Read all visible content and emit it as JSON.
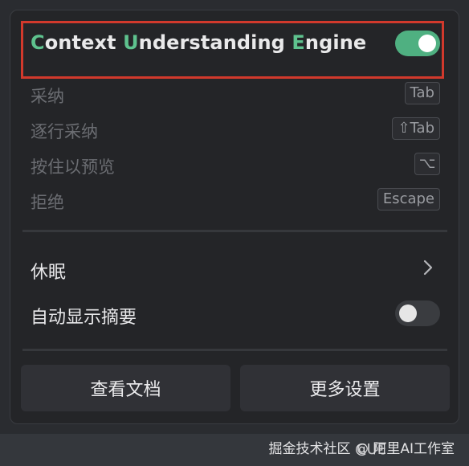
{
  "header": {
    "title_parts": [
      {
        "text": "C",
        "accent": true
      },
      {
        "text": "ontext ",
        "accent": false
      },
      {
        "text": "U",
        "accent": true
      },
      {
        "text": "nderstanding ",
        "accent": false
      },
      {
        "text": "E",
        "accent": true
      },
      {
        "text": "ngine",
        "accent": false
      }
    ],
    "engine_enabled": true
  },
  "shortcuts": [
    {
      "label": "采纳",
      "key": "Tab"
    },
    {
      "label": "逐行采纳",
      "key": "⇧Tab"
    },
    {
      "label": "按住以预览",
      "key": "⌥"
    },
    {
      "label": "拒绝",
      "key": "Escape"
    }
  ],
  "options": {
    "sleep_label": "休眠",
    "auto_summary_label": "自动显示摘要",
    "auto_summary_enabled": false
  },
  "footer": {
    "docs_button": "查看文档",
    "settings_button": "更多设置"
  },
  "statusbar": {
    "watermark": "掘金技术社区 @ 阿里AI工作室",
    "cue_label": "CUE"
  },
  "colors": {
    "accent": "#5ec28e",
    "toggle_on": "#4fb081",
    "highlight_border": "#d1392c"
  }
}
